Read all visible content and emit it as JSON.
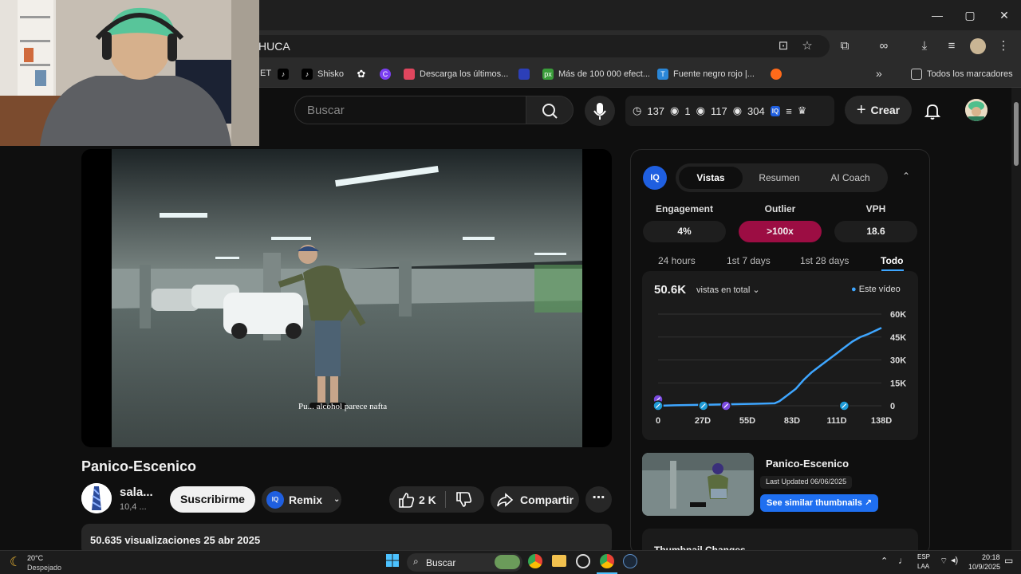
{
  "browser": {
    "window_controls": {
      "minimize": "—",
      "maximize": "▢",
      "close": "✕"
    },
    "url_fragment": "HUCA",
    "bookmarks": [
      {
        "label": "",
        "icon": "tiktok-icon"
      },
      {
        "label": "Shisko",
        "icon": "tiktok-icon"
      },
      {
        "label": "",
        "icon": "chatgpt-icon"
      },
      {
        "label": "",
        "icon": "canva-icon"
      },
      {
        "label": "Descarga los últimos...",
        "icon": "download-site-icon"
      },
      {
        "label": "",
        "icon": "bookmark-icon"
      },
      {
        "label": "Más de 100 000 efect...",
        "icon": "px-icon"
      },
      {
        "label": "Fuente negro rojo |...",
        "icon": "font-icon"
      },
      {
        "label": "",
        "icon": "bookmark-icon"
      }
    ],
    "bookmarks_more": "»",
    "all_bookmarks": "Todos los marcadores",
    "cut_label": "ET"
  },
  "youtube": {
    "search_placeholder": "Buscar",
    "stats": {
      "clock": "137",
      "eye1": "1",
      "eye2": "117",
      "eye3": "304"
    },
    "create_label": "Crear",
    "video": {
      "caption": "Pu... alcohol parece nafta",
      "title": "Panico-Escenico",
      "channel_name": "sala...",
      "channel_subs": "10,4 ...",
      "subscribe_label": "Suscribirme",
      "remix_label": "Remix",
      "likes": "2 K",
      "share_label": "Compartir",
      "more_label": "⋯",
      "description": "50.635 visualizaciones  25 abr 2025"
    }
  },
  "panel": {
    "logo": "IQ",
    "tabs": [
      "Vistas",
      "Resumen",
      "AI Coach"
    ],
    "active_tab": 0,
    "metrics": [
      {
        "label": "Engagement",
        "value": "4%"
      },
      {
        "label": "Outlier",
        "value": ">100x"
      },
      {
        "label": "VPH",
        "value": "18.6"
      }
    ],
    "colors": {
      "outlier": "#9c0d43",
      "line": "#3ea6ff",
      "accent": "#1f6ff0"
    },
    "time_tabs": [
      "24 hours",
      "1st 7 days",
      "1st 28 days",
      "Todo"
    ],
    "active_time_tab": 3,
    "chart_total": "50.6K",
    "chart_mode": "vistas en total",
    "legend": "Este vídeo",
    "side_video": {
      "title": "Panico-Escenico",
      "updated": "Last Updated 06/06/2025",
      "similar": "See similar thumbnails ↗"
    },
    "changes_title": "Thumbnail Changes"
  },
  "chart_data": {
    "type": "line",
    "x_tick_labels": [
      "0",
      "27D",
      "55D",
      "83D",
      "111D",
      "138D"
    ],
    "y_tick_labels": [
      "60K",
      "45K",
      "30K",
      "15K",
      "0"
    ],
    "xlim": [
      0,
      138
    ],
    "ylim": [
      0,
      60000
    ],
    "grid": true,
    "series": [
      {
        "name": "Este vídeo",
        "x": [
          0,
          10,
          20,
          30,
          40,
          50,
          60,
          72,
          75,
          80,
          85,
          90,
          95,
          100,
          105,
          110,
          115,
          120,
          125,
          130,
          138
        ],
        "y": [
          0,
          300,
          500,
          700,
          900,
          1100,
          1300,
          1600,
          3000,
          7000,
          11000,
          17000,
          22000,
          26000,
          30000,
          34000,
          38000,
          42000,
          45000,
          47000,
          51000
        ]
      }
    ],
    "markers": [
      {
        "x": 0,
        "kind": "purple"
      },
      {
        "x": 0,
        "kind": "blue"
      },
      {
        "x": 28,
        "kind": "blue"
      },
      {
        "x": 42,
        "kind": "purple"
      },
      {
        "x": 115,
        "kind": "blue"
      }
    ]
  },
  "taskbar": {
    "weather_temp": "20°C",
    "weather_desc": "Despejado",
    "search_label": "Buscar",
    "lang_top": "ESP",
    "lang_bottom": "LAA",
    "time": "20:18",
    "date": "10/9/2025"
  }
}
